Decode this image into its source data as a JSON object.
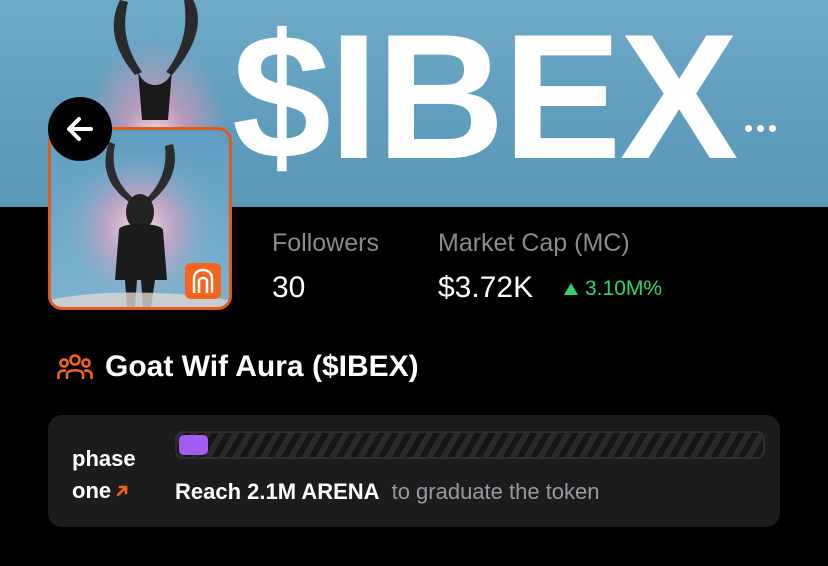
{
  "banner": {
    "title": "$IBEX",
    "more_icon": "more-dots-icon"
  },
  "back_icon": "arrow-left-icon",
  "avatar": {
    "badge_icon": "arena-logo-icon",
    "accent": "#e25a1e"
  },
  "stats": {
    "followers_label": "Followers",
    "followers_value": "30",
    "market_cap_label": "Market Cap (MC)",
    "market_cap_value": "$3.72K",
    "market_cap_change": "3.10M%",
    "change_color": "#33d46a"
  },
  "token": {
    "icon": "community-icon",
    "name": "Goat Wif Aura ($IBEX)"
  },
  "phase": {
    "label_line1": "phase",
    "label_line2": "one",
    "link_icon": "arrow-up-right-icon",
    "progress": 0.05,
    "progress_color": "#a35cf0",
    "goal_strong": "Reach 2.1M ARENA",
    "goal_rest": "to graduate the token"
  }
}
